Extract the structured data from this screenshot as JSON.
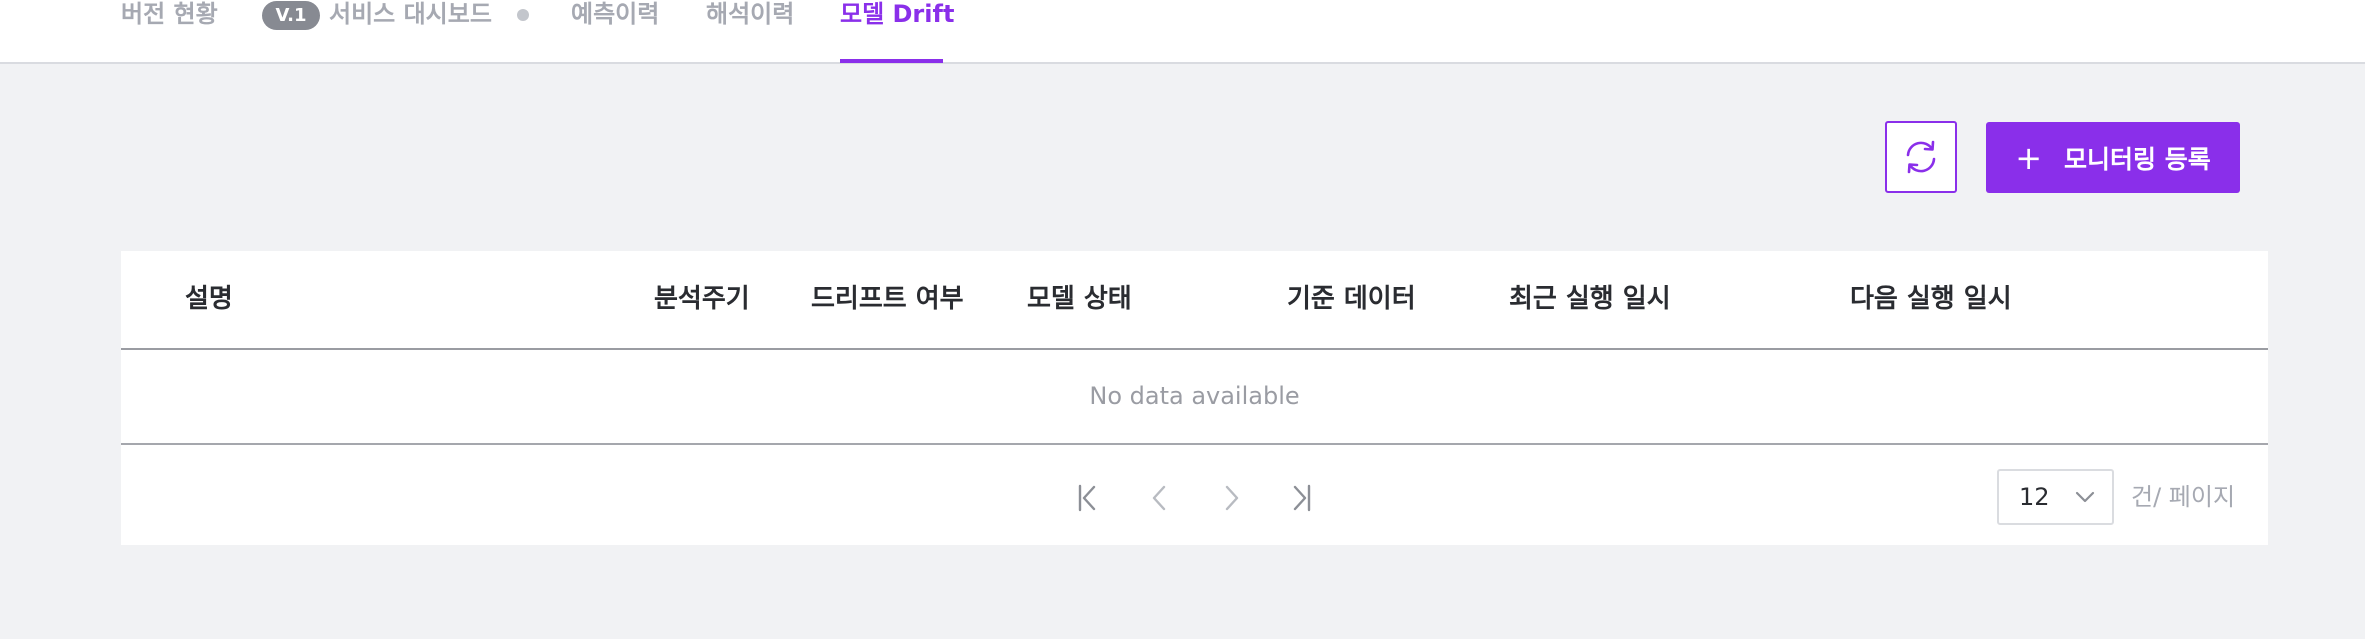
{
  "tabs": [
    {
      "label": "버전 현황"
    },
    {
      "badge": "V.1",
      "label": "서비스 대시보드"
    },
    {
      "label": "예측이력"
    },
    {
      "label": "해석이력"
    },
    {
      "label": "모델 Drift",
      "active": true
    }
  ],
  "toolbar": {
    "refresh_icon": "refresh-icon",
    "register_plus": "+",
    "register_label": "모니터링 등록"
  },
  "table": {
    "columns": [
      "설명",
      "분석주기",
      "드리프트 여부",
      "모델 상태",
      "기준 데이터",
      "최근 실행 일시",
      "다음 실행 일시"
    ],
    "empty_text": "No data available"
  },
  "pagination": {
    "page_size": "12",
    "per_page_label": "건/ 페이지"
  },
  "colors": {
    "accent": "#8a2fea",
    "background": "#f1f2f4",
    "badge": "#878a92"
  }
}
